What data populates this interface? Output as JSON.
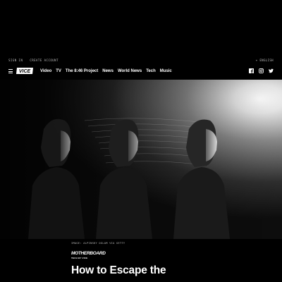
{
  "utility_bar": {
    "sign_in": "SIGN IN",
    "create_account": "CREATE ACCOUNT",
    "language": "+ ENGLISH"
  },
  "nav": {
    "logo_text": "VICE",
    "links": [
      "Video",
      "TV",
      "The 8:46 Project",
      "News",
      "World News",
      "Tech",
      "Music"
    ]
  },
  "social": [
    "facebook-icon",
    "instagram-icon",
    "twitter-icon"
  ],
  "hero": {
    "credit": "IMAGE: ALPINSKY OGLAM VIA GETTY"
  },
  "article": {
    "section_name": "MOTHERBOARD",
    "section_sub": "TECH BY VICE",
    "headline": "How to Escape the"
  }
}
